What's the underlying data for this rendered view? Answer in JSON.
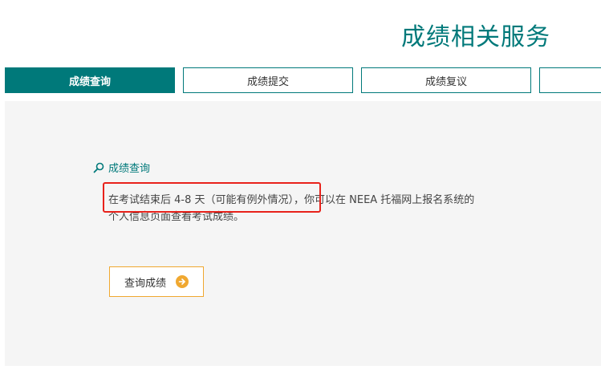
{
  "header": {
    "title": "成绩相关服务"
  },
  "tabs": [
    {
      "label": "成绩查询",
      "active": true
    },
    {
      "label": "成绩提交",
      "active": false
    },
    {
      "label": "成绩复议",
      "active": false
    },
    {
      "label": "",
      "active": false
    }
  ],
  "section": {
    "icon": "search-icon",
    "title": "成绩查询",
    "description_line1": "在考试结束后 4-8 天（可能有例外情况），你可以在 NEEA 托福网上报名系统的",
    "description_line2": "个人信息页面查看考试成绩。"
  },
  "query_button": {
    "label": "查询成绩",
    "icon": "arrow-right-circle-icon"
  },
  "colors": {
    "accent": "#00797a",
    "button_border": "#f0a830",
    "highlight": "#e8221b",
    "panel_bg": "#f5f5f5"
  }
}
